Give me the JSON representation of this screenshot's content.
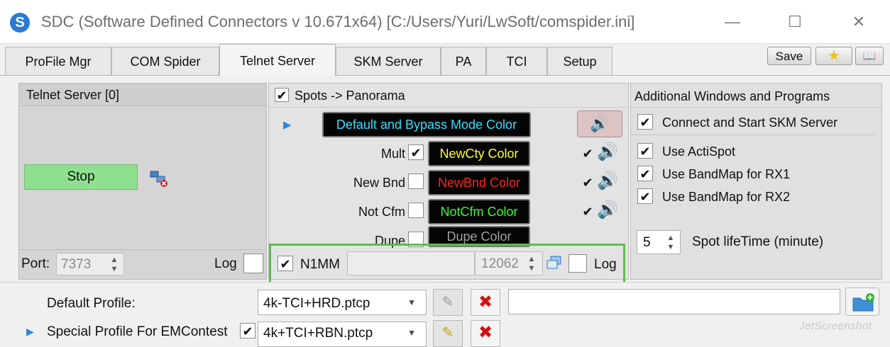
{
  "window": {
    "app_icon_letter": "S",
    "title": "SDC (Software Defined Connectors v 10.671x64) [C:/Users/Yuri/LwSoft/comspider.ini]",
    "minimize_glyph": "—",
    "maximize_glyph": "☐",
    "close_glyph": "✕"
  },
  "tabs": [
    {
      "label": "ProFile Mgr"
    },
    {
      "label": "COM Spider"
    },
    {
      "label": "Telnet Server",
      "active": true
    },
    {
      "label": "SKM Server"
    },
    {
      "label": "PA"
    },
    {
      "label": "TCI"
    },
    {
      "label": "Setup"
    }
  ],
  "toolbar": {
    "save_label": "Save",
    "star_glyph": "★",
    "book_glyph": "📖"
  },
  "telnet_panel": {
    "title": "Telnet Server [0]",
    "stop_label": "Stop",
    "port_label": "Port:",
    "port_value": "7373",
    "log_label": "Log"
  },
  "spots_panel": {
    "header_checked": true,
    "header_label": "Spots -> Panorama",
    "default_color_label": "Default and Bypass Mode Color",
    "rows": [
      {
        "label": "Mult",
        "checked": true,
        "color_label": "NewCty Color",
        "color": "#ffff33",
        "sound_checked": true
      },
      {
        "label": "New Bnd",
        "checked": false,
        "color_label": "NewBnd Color",
        "color": "#ff2020",
        "sound_checked": true
      },
      {
        "label": "Not Cfm",
        "checked": false,
        "color_label": "NotCfm Color",
        "color": "#33ff33",
        "sound_checked": true
      },
      {
        "label": "Dupe",
        "checked": false,
        "color_label": "Dupe Color",
        "color": "#a0a0a0"
      }
    ],
    "n1mm_checked": true,
    "n1mm_label": "N1MM",
    "n1mm_port": "12062",
    "log_label": "Log"
  },
  "additional_panel": {
    "title": "Additional Windows and Programs",
    "items": [
      {
        "label": "Connect and Start SKM Server",
        "checked": true
      },
      {
        "label": "Use ActiSpot",
        "checked": true
      },
      {
        "label": "Use BandMap for RX1",
        "checked": true
      },
      {
        "label": "Use BandMap for RX2",
        "checked": true
      }
    ],
    "lifetime_value": "5",
    "lifetime_label": "Spot lifeTime (minute)"
  },
  "bottom": {
    "default_profile_label": "Default Profile:",
    "default_profile_value": "4k-TCI+HRD.ptcp",
    "special_profile_label": "Special Profile For EMContest",
    "special_profile_value": "4k+TCI+RBN.ptcp",
    "watermark": "JetScreenshot"
  },
  "colors": {
    "default_color_text": "#33e0ff",
    "highlight_border": "#5cbf4a",
    "stop_button": "#8ee08e"
  }
}
